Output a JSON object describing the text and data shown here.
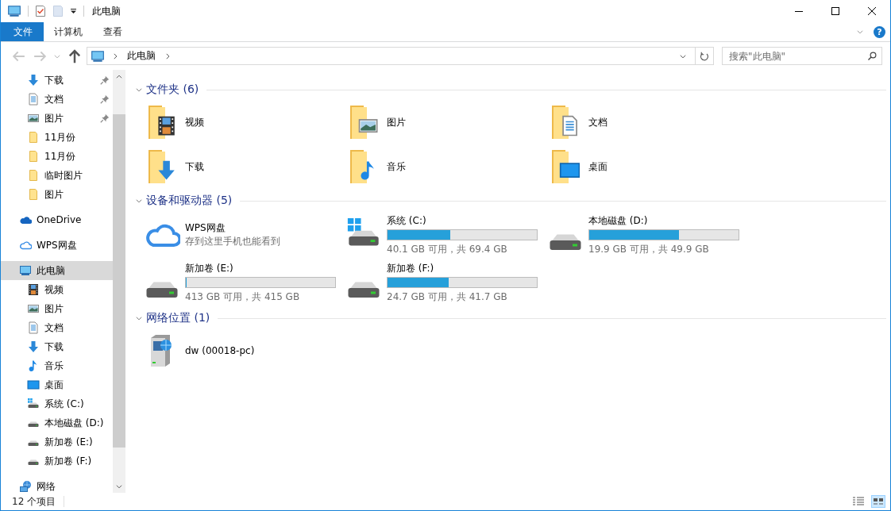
{
  "window": {
    "title": "此电脑"
  },
  "ribbon": {
    "tabs": [
      {
        "label": "文件",
        "selected": true
      },
      {
        "label": "计算机",
        "selected": false
      },
      {
        "label": "查看",
        "selected": false
      }
    ],
    "help": "?"
  },
  "navigation": {
    "back": {
      "disabled": true
    },
    "forward": {
      "disabled": true
    },
    "up": {
      "disabled": false
    }
  },
  "address_bar": {
    "breadcrumb": [
      "此电脑"
    ]
  },
  "search": {
    "placeholder": "搜索\"此电脑\""
  },
  "sidebar": {
    "quick_access": [
      {
        "label": "下载",
        "kind": "download",
        "pinned": true,
        "selected": false
      },
      {
        "label": "文档",
        "kind": "document",
        "pinned": true,
        "selected": false
      },
      {
        "label": "图片",
        "kind": "picture",
        "pinned": true,
        "selected": false
      },
      {
        "label": "11月份",
        "kind": "folder",
        "pinned": false,
        "selected": false
      },
      {
        "label": "11月份",
        "kind": "folder",
        "pinned": false,
        "selected": false
      },
      {
        "label": "临时图片",
        "kind": "folder",
        "pinned": false,
        "selected": false
      },
      {
        "label": "图片",
        "kind": "folder",
        "pinned": false,
        "selected": false
      }
    ],
    "items": [
      {
        "label": "OneDrive",
        "kind": "onedrive",
        "selected": false
      },
      {
        "label": "WPS网盘",
        "kind": "cloud",
        "selected": false
      },
      {
        "label": "此电脑",
        "kind": "pc",
        "selected": true,
        "children": [
          {
            "label": "视频",
            "kind": "video",
            "selected": false
          },
          {
            "label": "图片",
            "kind": "picture",
            "selected": false
          },
          {
            "label": "文档",
            "kind": "document",
            "selected": false
          },
          {
            "label": "下载",
            "kind": "download",
            "selected": false
          },
          {
            "label": "音乐",
            "kind": "music",
            "selected": false
          },
          {
            "label": "桌面",
            "kind": "desktop",
            "selected": false
          },
          {
            "label": "系统 (C:)",
            "kind": "drive-system",
            "selected": false
          },
          {
            "label": "本地磁盘 (D:)",
            "kind": "drive",
            "selected": false
          },
          {
            "label": "新加卷 (E:)",
            "kind": "drive",
            "selected": false
          },
          {
            "label": "新加卷 (F:)",
            "kind": "drive",
            "selected": false
          }
        ]
      },
      {
        "label": "网络",
        "kind": "network",
        "selected": false
      }
    ]
  },
  "sections": [
    {
      "title": "文件夹 (6)",
      "expanded": true,
      "items": [
        {
          "kind": "video",
          "label": "视频"
        },
        {
          "kind": "picture",
          "label": "图片"
        },
        {
          "kind": "document",
          "label": "文档"
        },
        {
          "kind": "download",
          "label": "下载"
        },
        {
          "kind": "music",
          "label": "音乐"
        },
        {
          "kind": "desktop",
          "label": "桌面"
        }
      ]
    },
    {
      "title": "设备和驱动器 (5)",
      "expanded": true,
      "items": [
        {
          "kind": "cloud",
          "label": "WPS网盘",
          "subtitle": "存到这里手机也能看到"
        },
        {
          "kind": "drive-system",
          "label": "系统 (C:)",
          "level": 0.42,
          "reading": "40.1 GB 可用，共 69.4 GB"
        },
        {
          "kind": "drive",
          "label": "本地磁盘 (D:)",
          "level": 0.6,
          "reading": "19.9 GB 可用，共 49.9 GB"
        },
        {
          "kind": "drive",
          "label": "新加卷 (E:)",
          "level": 0.005,
          "reading": "413 GB 可用，共 415 GB"
        },
        {
          "kind": "drive",
          "label": "新加卷 (F:)",
          "level": 0.41,
          "reading": "24.7 GB 可用，共 41.7 GB"
        }
      ]
    },
    {
      "title": "网络位置 (1)",
      "expanded": true,
      "items": [
        {
          "kind": "network",
          "label": "dw (00018-pc)"
        }
      ]
    }
  ],
  "status_bar": {
    "item_count": "12 个项目"
  }
}
